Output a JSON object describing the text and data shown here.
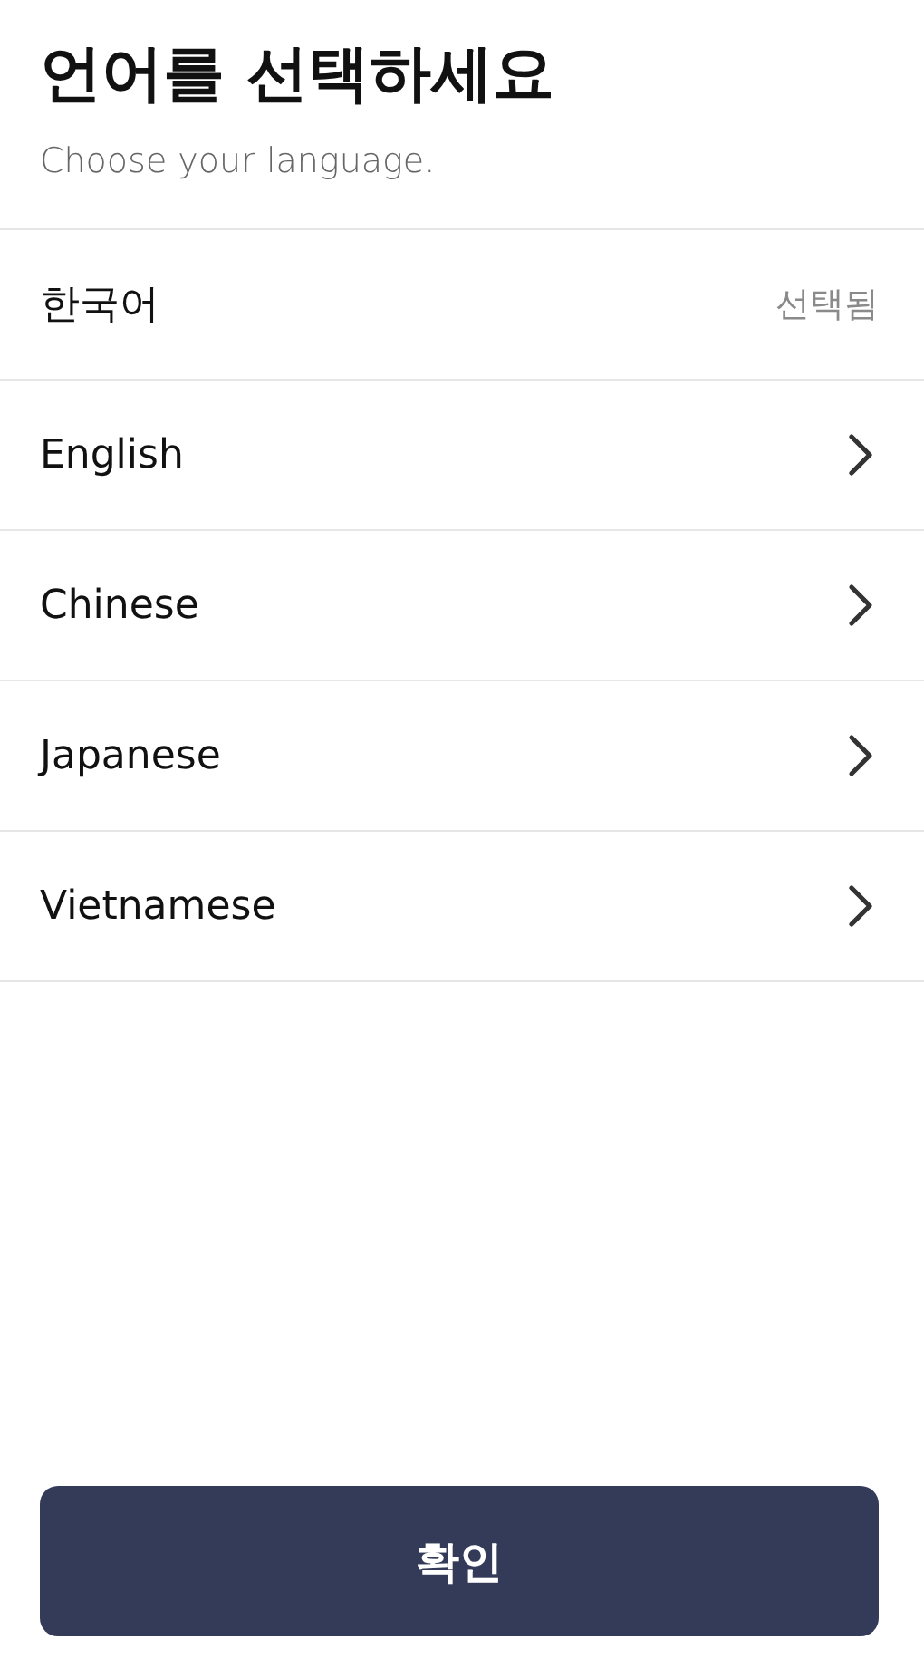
{
  "header": {
    "title": "언어를 선택하세요",
    "subtitle": "Choose your language."
  },
  "selected_text": "선택됨",
  "languages": [
    {
      "label": "한국어",
      "selected": true
    },
    {
      "label": "English",
      "selected": false
    },
    {
      "label": "Chinese",
      "selected": false
    },
    {
      "label": "Japanese",
      "selected": false
    },
    {
      "label": "Vietnamese",
      "selected": false
    }
  ],
  "confirm_button": "확인"
}
